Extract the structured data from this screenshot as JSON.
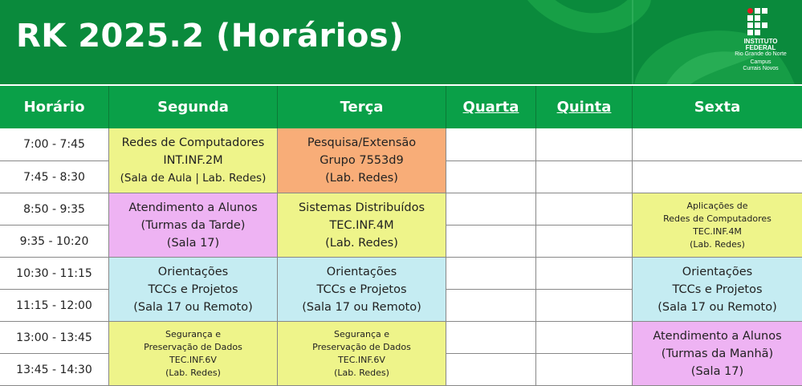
{
  "title": "RK 2025.2 (Horários)",
  "logo": {
    "line1": "INSTITUTO",
    "line2": "FEDERAL",
    "line3": "Rio Grande do Norte",
    "line4": "Campus",
    "line5": "Currais Novos"
  },
  "colors": {
    "header_bg": "#0a8a3c",
    "column_header_bg": "#0aa048",
    "yellow": "#eef48a",
    "orange": "#f8ad78",
    "pink": "#eeb3f3",
    "cyan": "#c5ecf2"
  },
  "columns": [
    "Horário",
    "Segunda",
    "Terça",
    "Quarta",
    "Quinta",
    "Sexta"
  ],
  "times": [
    "7:00 - 7:45",
    "7:45 - 8:30",
    "8:50 - 9:35",
    "9:35 - 10:20",
    "10:30 - 11:15",
    "11:15 - 12:00",
    "13:00 - 13:45",
    "13:45 - 14:30"
  ],
  "blocks": {
    "seg_1": [
      "Redes de Computadores",
      "INT.INF.2M",
      "(Sala de Aula | Lab. Redes)"
    ],
    "ter_1": [
      "Pesquisa/Extensão",
      "Grupo 7553d9",
      "(Lab. Redes)"
    ],
    "seg_2": [
      "Atendimento a Alunos",
      "(Turmas da Tarde)",
      "(Sala 17)"
    ],
    "ter_2": [
      "Sistemas Distribuídos",
      "TEC.INF.4M",
      "(Lab. Redes)"
    ],
    "sex_2": [
      "Aplicações de",
      "Redes de Computadores",
      "TEC.INF.4M",
      "(Lab. Redes)"
    ],
    "seg_3": [
      "Orientações",
      "TCCs e Projetos",
      "(Sala 17 ou Remoto)"
    ],
    "ter_3": [
      "Orientações",
      "TCCs e Projetos",
      "(Sala 17 ou Remoto)"
    ],
    "sex_3": [
      "Orientações",
      "TCCs e Projetos",
      "(Sala 17 ou Remoto)"
    ],
    "seg_4": [
      "Segurança e",
      "Preservação de Dados",
      "TEC.INF.6V",
      "(Lab. Redes)"
    ],
    "ter_4": [
      "Segurança e",
      "Preservação de Dados",
      "TEC.INF.6V",
      "(Lab. Redes)"
    ],
    "sex_4": [
      "Atendimento a Alunos",
      "(Turmas da Manhã)",
      "(Sala 17)"
    ]
  }
}
